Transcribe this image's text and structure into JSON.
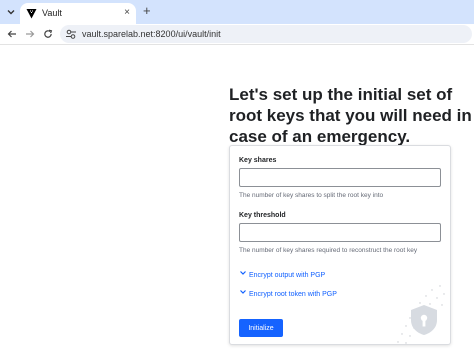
{
  "browser": {
    "tab": {
      "title": "Vault",
      "close_glyph": "×"
    },
    "new_tab_glyph": "+",
    "url": "vault.sparelab.net:8200/ui/vault/init"
  },
  "page": {
    "heading": "Let's set up the initial set of root keys that you will need in case of an emergency.",
    "fields": [
      {
        "label": "Key shares",
        "value": "",
        "help": "The number of key shares to split the root key into"
      },
      {
        "label": "Key threshold",
        "value": "",
        "help": "The number of key shares required to reconstruct the root key"
      }
    ],
    "toggles": [
      {
        "label": "Encrypt output with PGP",
        "icon": "chevron-down-icon"
      },
      {
        "label": "Encrypt root token with PGP",
        "icon": "chevron-down-icon"
      }
    ],
    "submit_label": "Initialize"
  },
  "colors": {
    "accent": "#1563ff",
    "link": "#1060ff",
    "tabbar": "#d3e3fd"
  }
}
